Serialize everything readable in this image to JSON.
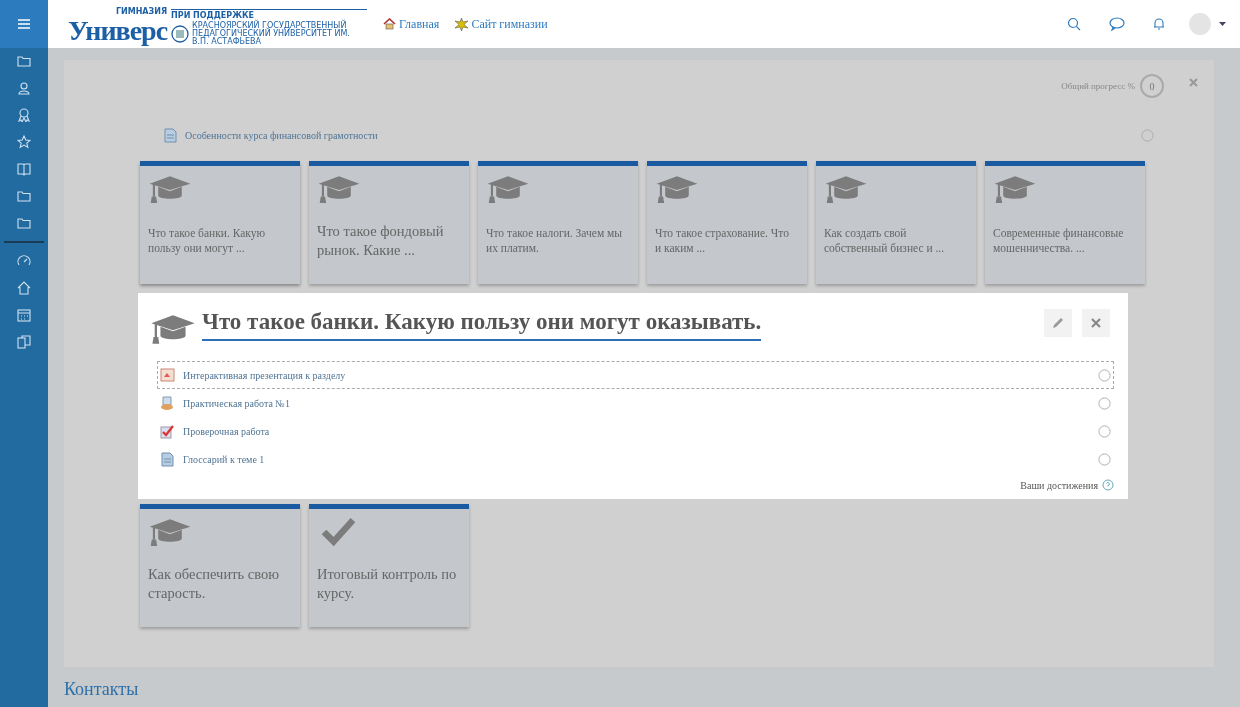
{
  "logo": {
    "top_label": "ГИМНАЗИЯ",
    "name": "Универс",
    "support_label": "ПРИ ПОДДЕРЖКЕ",
    "university": "КРАСНОЯРСКИЙ ГОСУДАРСТВЕННЫЙ ПЕДАГОГИЧЕСКИЙ УНИВЕРСИТЕТ ИМ. В.П. АСТАФЬЕВА"
  },
  "nav_links": [
    {
      "kind": "home",
      "label": "Главная"
    },
    {
      "kind": "site",
      "label": "Сайт гимназии"
    }
  ],
  "sidebar": {
    "items": [
      {
        "kind": "folder"
      },
      {
        "kind": "users"
      },
      {
        "kind": "award"
      },
      {
        "kind": "star"
      },
      {
        "kind": "book"
      },
      {
        "kind": "folder"
      },
      {
        "kind": "folder"
      },
      {
        "kind": "divider"
      },
      {
        "kind": "dashboard"
      },
      {
        "kind": "home"
      },
      {
        "kind": "calendar"
      },
      {
        "kind": "copy"
      }
    ]
  },
  "progress": {
    "label": "Общий прогресс %",
    "value": "0"
  },
  "intro_activity": {
    "label": "Особенности курса финансовой грамотности",
    "completed": false
  },
  "sections": [
    {
      "title": "Что такое банки. Какую пользу они могут ...",
      "kind": "cap",
      "expanded": true
    },
    {
      "title": "Что такое фондовый рынок. Какие ...",
      "kind": "cap",
      "expanded": false
    },
    {
      "title": "Что такое налоги. Зачем мы их платим.",
      "kind": "cap",
      "expanded": false
    },
    {
      "title": "Что такое страхование. Что и каким ...",
      "kind": "cap",
      "expanded": false
    },
    {
      "title": "Как создать свой собственный бизнес и ...",
      "kind": "cap",
      "expanded": false
    },
    {
      "title": "Современные финансовые мошенничества. ...",
      "kind": "cap",
      "expanded": false
    },
    {
      "title": "Как обеспечить свою старость.",
      "kind": "cap",
      "expanded": false
    },
    {
      "title": "Итоговый контроль по курсу.",
      "kind": "check",
      "expanded": false
    }
  ],
  "expanded_section": {
    "title": "Что такое банки. Какую пользу они могут оказывать.",
    "activities": [
      {
        "kind": "presentation",
        "label": "Интерактивная презентация к разделу",
        "selected": true,
        "completed": false
      },
      {
        "kind": "assignment",
        "label": "Практическая работа №1",
        "selected": false,
        "completed": false
      },
      {
        "kind": "quiz",
        "label": "Проверочная работа",
        "selected": false,
        "completed": false
      },
      {
        "kind": "page",
        "label": "Глоссарий к теме 1",
        "selected": false,
        "completed": false
      }
    ],
    "achievements_label": "Ваши достижения"
  },
  "footer_heading": "Контакты"
}
